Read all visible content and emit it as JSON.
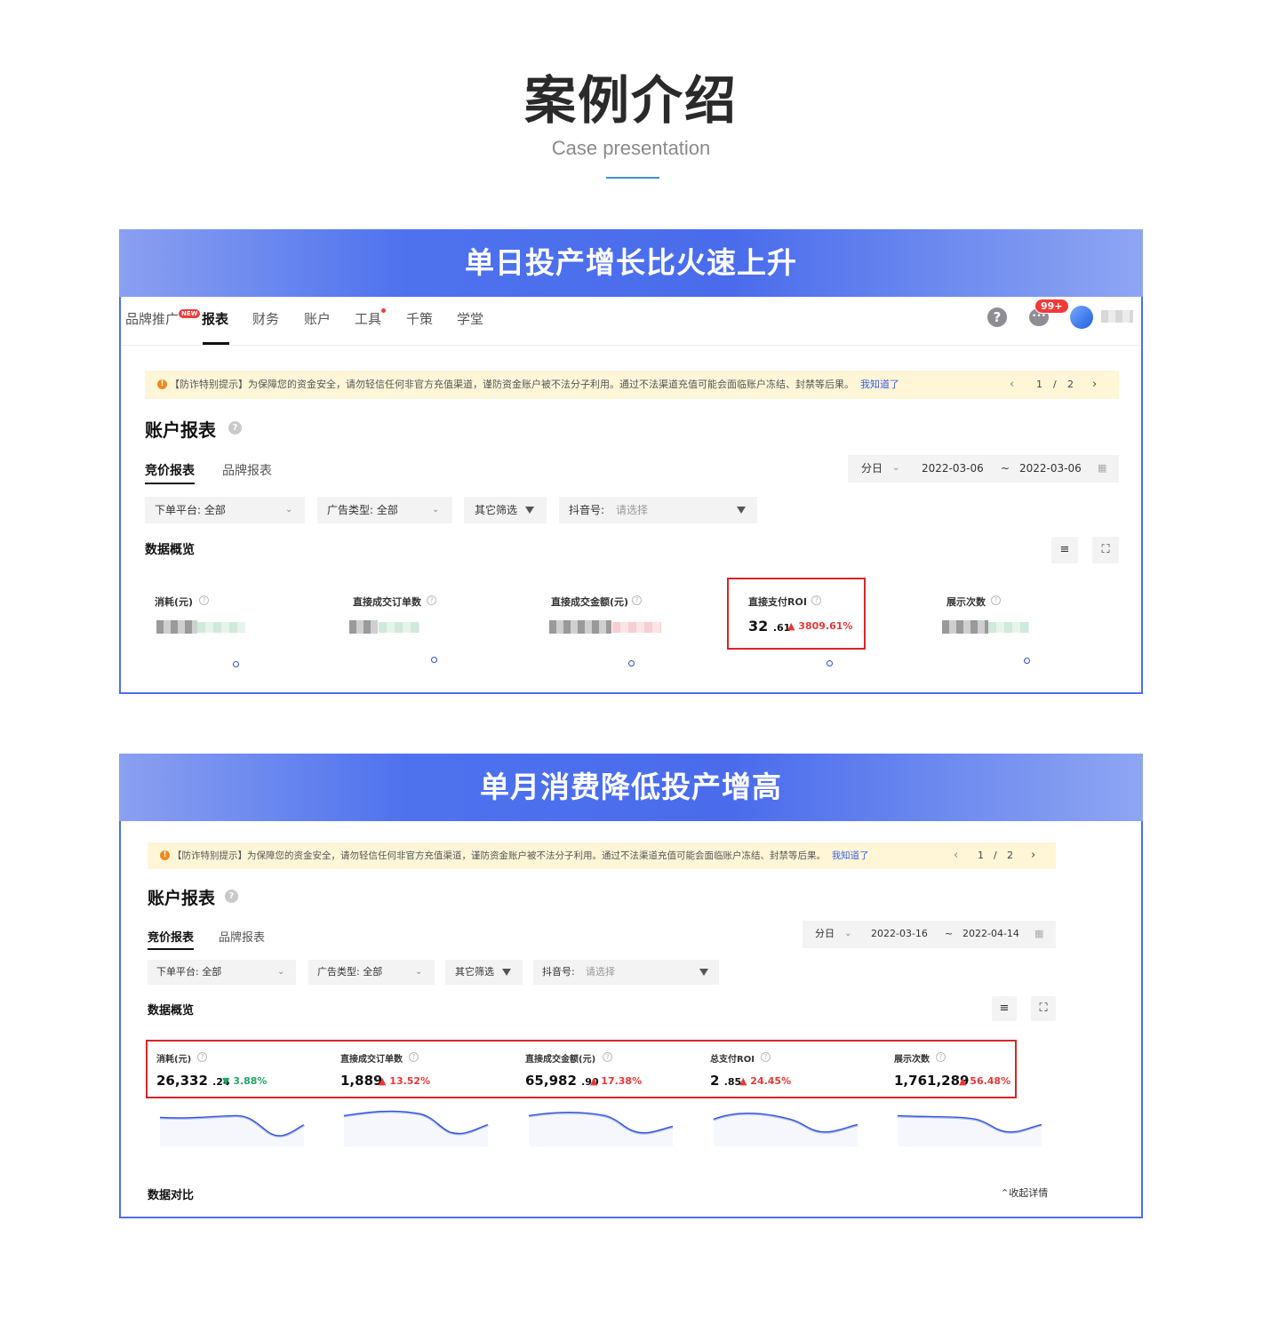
{
  "header": {
    "title": "案例介绍",
    "subtitle": "Case presentation"
  },
  "case1": {
    "banner": "单日投产增长比火速上升",
    "nav": {
      "items": [
        "品牌推广",
        "报表",
        "财务",
        "账户",
        "工具",
        "千策",
        "学堂"
      ],
      "new_badge": "NEW",
      "msg_badge": "99+"
    },
    "notice": {
      "text": "【防诈特别提示】为保障您的资金安全，请勿轻信任何非官方充值渠道，谨防资金账户被不法分子利用。通过不法渠道充值可能会面临账户冻结、封禁等后果。",
      "link": "我知道了",
      "page": "1",
      "sep": "/",
      "total": "2"
    },
    "report_title": "账户报表",
    "tabs": [
      "竞价报表",
      "品牌报表"
    ],
    "date": {
      "granularity": "分日",
      "start": "2022-03-06",
      "tilde": "~",
      "end": "2022-03-06"
    },
    "filters": {
      "platform": "下单平台: 全部",
      "ad_type": "广告类型: 全部",
      "other": "其它筛选",
      "douyin_label": "抖音号:",
      "douyin_placeholder": "请选择"
    },
    "overview_title": "数据概览",
    "metrics": [
      {
        "label": "消耗(元)"
      },
      {
        "label": "直接成交订单数"
      },
      {
        "label": "直接成交金额(元)"
      },
      {
        "label": "直接支付ROI",
        "value": "32",
        "decimal": ".61",
        "change": "3809.61%",
        "direction": "up"
      },
      {
        "label": "展示次数"
      }
    ]
  },
  "case2": {
    "banner": "单月消费降低投产增高",
    "notice": {
      "text": "【防诈特别提示】为保障您的资金安全，请勿轻信任何非官方充值渠道，谨防资金账户被不法分子利用。通过不法渠道充值可能会面临账户冻结、封禁等后果。",
      "link": "我知道了",
      "page": "1",
      "sep": "/",
      "total": "2"
    },
    "report_title": "账户报表",
    "tabs": [
      "竞价报表",
      "品牌报表"
    ],
    "date": {
      "granularity": "分日",
      "start": "2022-03-16",
      "tilde": "~",
      "end": "2022-04-14"
    },
    "filters": {
      "platform": "下单平台: 全部",
      "ad_type": "广告类型: 全部",
      "other": "其它筛选",
      "douyin_label": "抖音号:",
      "douyin_placeholder": "请选择"
    },
    "overview_title": "数据概览",
    "metrics": [
      {
        "label": "消耗(元)",
        "value": "26,332",
        "decimal": ".24",
        "change": "3.88%",
        "direction": "down"
      },
      {
        "label": "直接成交订单数",
        "value": "1,889",
        "decimal": "",
        "change": "13.52%",
        "direction": "up"
      },
      {
        "label": "直接成交金额(元)",
        "value": "65,982",
        "decimal": ".90",
        "change": "17.38%",
        "direction": "up"
      },
      {
        "label": "总支付ROI",
        "value": "2",
        "decimal": ".85",
        "change": "24.45%",
        "direction": "up"
      },
      {
        "label": "展示次数",
        "value": "1,761,289",
        "decimal": "",
        "change": "56.48%",
        "direction": "up"
      }
    ],
    "compare_title": "数据对比",
    "collapse_label": "收起详情"
  },
  "colors": {
    "accent": "#4d6fe6",
    "up": "#e53935",
    "down": "#21a366",
    "highlight": "#d9252a"
  }
}
